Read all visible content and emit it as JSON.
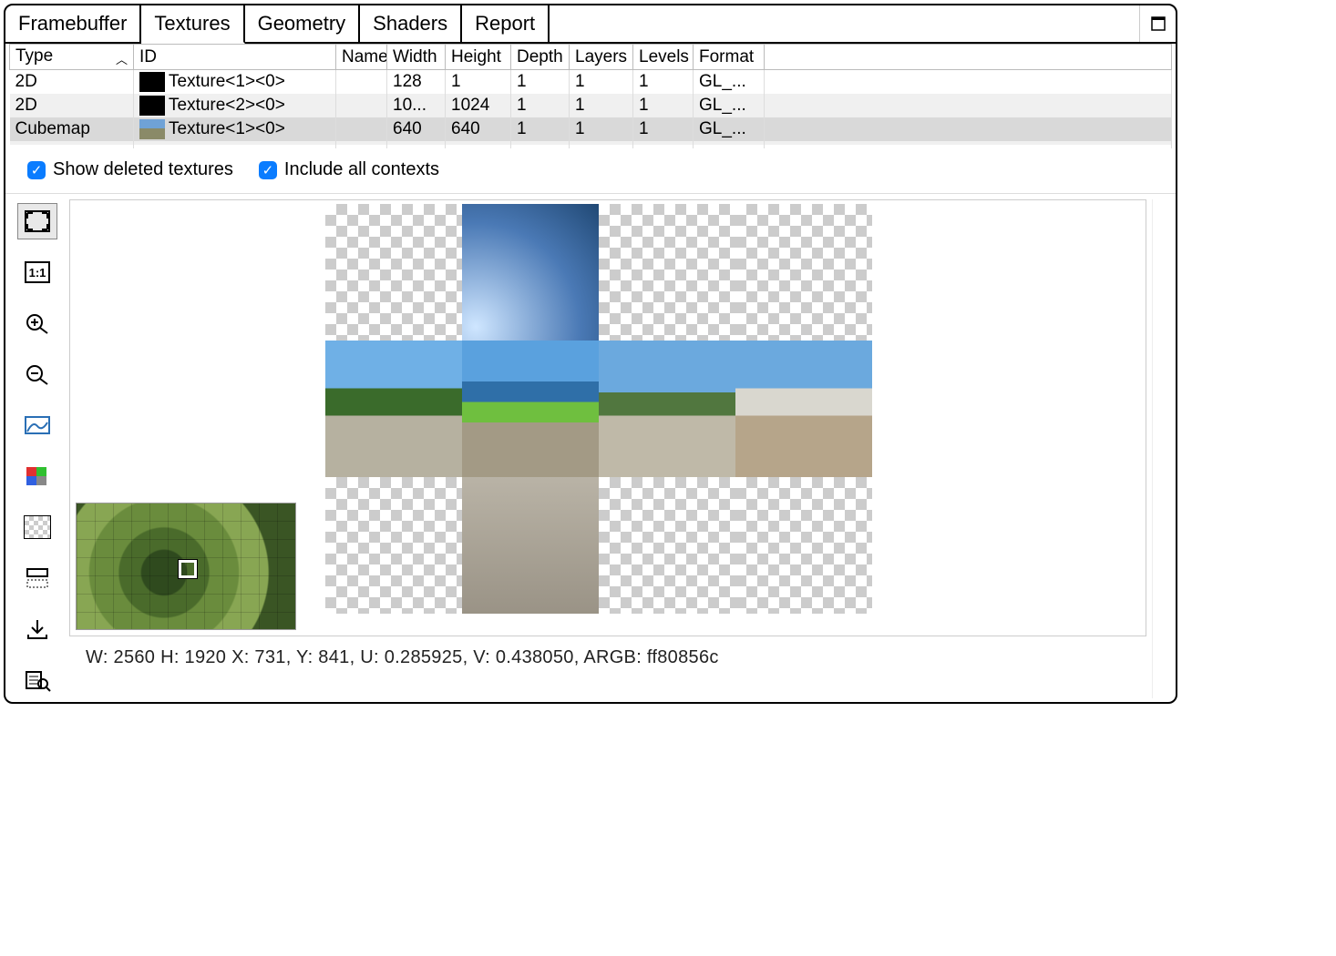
{
  "tabs": {
    "framebuffer": "Framebuffer",
    "textures": "Textures",
    "geometry": "Geometry",
    "shaders": "Shaders",
    "report": "Report",
    "active": "textures"
  },
  "columns": {
    "type": "Type",
    "id": "ID",
    "name": "Name",
    "width": "Width",
    "height": "Height",
    "depth": "Depth",
    "layers": "Layers",
    "levels": "Levels",
    "format": "Format"
  },
  "rows": [
    {
      "type": "2D",
      "id": "Texture<1><0>",
      "name": "",
      "width": "128",
      "height": "1",
      "depth": "1",
      "layers": "1",
      "levels": "1",
      "format": "GL_...",
      "thumb": "black"
    },
    {
      "type": "2D",
      "id": "Texture<2><0>",
      "name": "",
      "width": "10...",
      "height": "1024",
      "depth": "1",
      "layers": "1",
      "levels": "1",
      "format": "GL_...",
      "thumb": "black"
    },
    {
      "type": "Cubemap",
      "id": "Texture<1><0>",
      "name": "",
      "width": "640",
      "height": "640",
      "depth": "1",
      "layers": "1",
      "levels": "1",
      "format": "GL_...",
      "thumb": "cube",
      "selected": true
    }
  ],
  "options": {
    "show_deleted": "Show deleted textures",
    "include_all": "Include all contexts"
  },
  "tools": {
    "fit": "zoom-to-fit-icon",
    "actual": "actual-size-icon",
    "zoomin": "zoom-in-icon",
    "zoomout": "zoom-out-icon",
    "histogram": "histogram-icon",
    "channels": "color-channels-icon",
    "checker": "background-checker-icon",
    "flip": "flip-vertical-icon",
    "save": "save-icon",
    "inspect": "inspect-pixel-icon"
  },
  "status": {
    "text": "W: 2560 H: 1920   X: 731, Y: 841, U: 0.285925, V: 0.438050, ARGB: ff80856c"
  }
}
